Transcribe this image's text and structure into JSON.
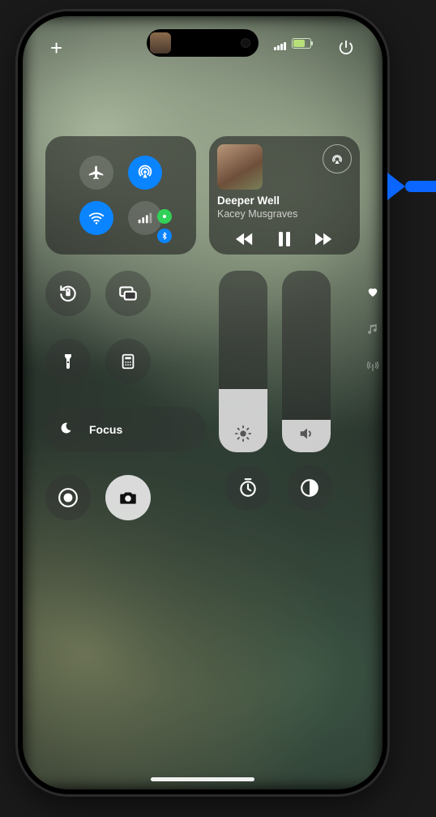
{
  "statusbar": {
    "add_label": "+"
  },
  "connectivity": {
    "airplane": {
      "on": false
    },
    "airdrop": {
      "on": true
    },
    "wifi": {
      "on": true
    },
    "cellular": {
      "on": false
    },
    "bluetooth": {
      "on": true
    },
    "hotspot": {
      "on": true
    }
  },
  "media": {
    "title": "Deeper Well",
    "artist": "Kacey Musgraves",
    "state": "paused"
  },
  "sliders": {
    "brightness": {
      "percent": 35
    },
    "volume": {
      "percent": 18
    }
  },
  "focus": {
    "label": "Focus"
  },
  "colors": {
    "accent": "#0a84ff",
    "pointer": "#0a66ff"
  }
}
